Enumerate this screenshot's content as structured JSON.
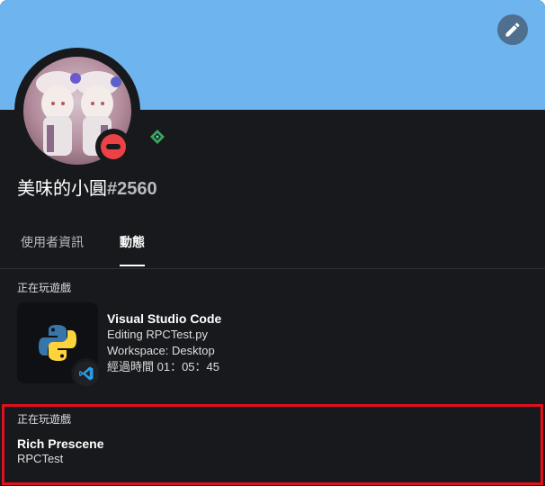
{
  "profile": {
    "username": "美味的小圓",
    "discriminator": "#2560"
  },
  "tabs": [
    {
      "label": "使用者資訊"
    },
    {
      "label": "動態"
    }
  ],
  "activity": {
    "label": "正在玩遊戲",
    "app": "Visual Studio Code",
    "details": "Editing RPCTest.py",
    "state": "Workspace: Desktop",
    "elapsed": "經過時間 01：05：45"
  },
  "rich_presence": {
    "label": "正在玩遊戲",
    "name": "Rich Prescene",
    "details": "RPCTest"
  },
  "colors": {
    "banner": "#6eb4ee",
    "card": "#18191c",
    "status_dnd": "#ed4245",
    "highlight": "#e0101d",
    "badge": "#3ba55c"
  },
  "icons": {
    "edit": "pencil-icon",
    "status": "do-not-disturb-icon",
    "badge": "hypesquad-balance-icon",
    "activity_large": "python-logo-icon",
    "activity_small": "vscode-logo-icon"
  }
}
